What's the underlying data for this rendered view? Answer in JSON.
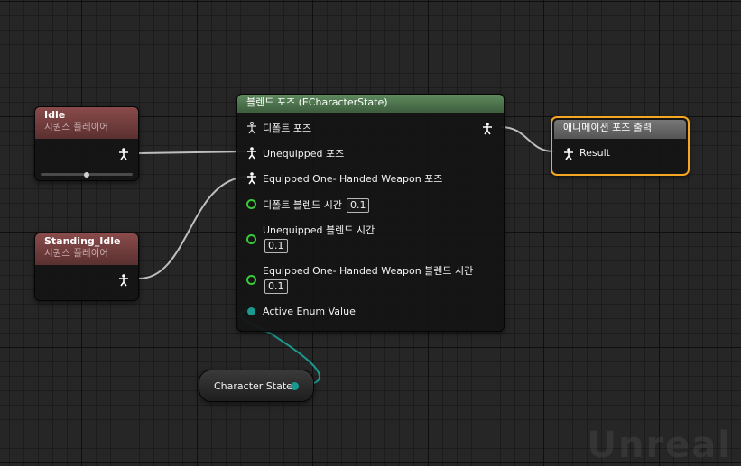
{
  "nodes": {
    "idle": {
      "title": "Idle",
      "subtitle": "시퀀스 플레이어",
      "playback_position": 0.5
    },
    "standing_idle": {
      "title": "Standing_Idle",
      "subtitle": "시퀀스 플레이어"
    },
    "blend_poses": {
      "title": "블렌드 포즈 (ECharacterState)",
      "pins": {
        "default_pose": "디폴트 포즈",
        "unequipped_pose": "Unequipped 포즈",
        "equipped_pose": "Equipped One- Handed Weapon 포즈",
        "default_blend_time_label": "디폴트 블렌드 시간",
        "default_blend_time_value": "0.1",
        "unequipped_blend_time_label": "Unequipped 블렌드 시간",
        "unequipped_blend_time_value": "0.1",
        "equipped_blend_time_label": "Equipped One- Handed Weapon 블렌드 시간",
        "equipped_blend_time_value": "0.1",
        "active_enum_value": "Active Enum Value"
      }
    },
    "output_pose": {
      "title": "애니메이션 포즈 출력",
      "result_label": "Result"
    },
    "character_state": {
      "label": "Character State"
    }
  },
  "colors": {
    "pose_wire": "#bfbfbf",
    "enum_wire": "#1a9a8e",
    "float_pin": "#39c939",
    "output_border": "#f5a623",
    "sequence_header": "#8a4b4b",
    "blend_header": "#5e8a5e"
  },
  "icons": {
    "pose_pin": "pose-person-icon",
    "float_pin": "float-pin-icon",
    "enum_pin": "enum-pin-icon"
  },
  "watermark": "Unreal"
}
